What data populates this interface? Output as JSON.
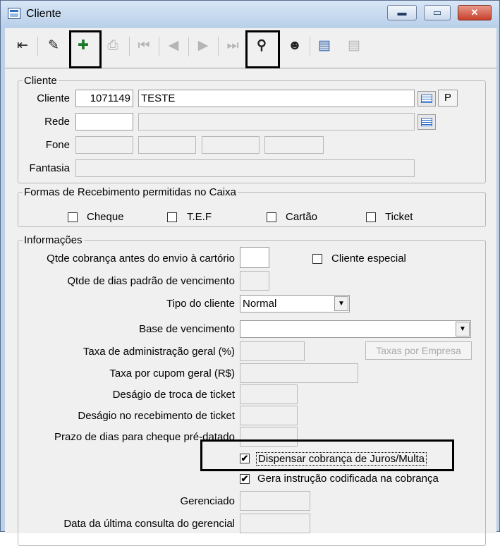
{
  "window": {
    "title": "Cliente",
    "controls": {
      "minimize": "▬",
      "maximize": "▭",
      "close": "✕"
    }
  },
  "toolbar": {
    "buttons": [
      {
        "name": "exit-icon",
        "glyph": "⇤"
      },
      {
        "name": "edit-icon",
        "glyph": "✎"
      },
      {
        "name": "add-icon",
        "glyph": "✚"
      },
      {
        "name": "save-icon",
        "glyph": "⎙"
      },
      {
        "name": "first-record-icon",
        "glyph": "⏮"
      },
      {
        "name": "prev-record-icon",
        "glyph": "◀"
      },
      {
        "name": "next-record-icon",
        "glyph": "▶"
      },
      {
        "name": "last-record-icon",
        "glyph": "⏭"
      },
      {
        "name": "binoculars-icon",
        "glyph": "⚲"
      },
      {
        "name": "person-icon",
        "glyph": "☻"
      },
      {
        "name": "document-icon",
        "glyph": "▤"
      },
      {
        "name": "document-disabled-icon",
        "glyph": "▤"
      }
    ]
  },
  "cliente": {
    "legend": "Cliente",
    "cliente_label": "Cliente",
    "cliente_code": "1071149",
    "cliente_name": "TESTE",
    "p_button": "P",
    "rede_label": "Rede",
    "fone_label": "Fone",
    "fantasia_label": "Fantasia"
  },
  "formas": {
    "legend": "Formas de Recebimento permitidas no Caixa",
    "options": [
      "Cheque",
      "T.E.F",
      "Cartão",
      "Ticket"
    ]
  },
  "informacoes": {
    "legend": "Informações",
    "qtde_cobranca_label": "Qtde cobrança antes do envio à cartório",
    "cliente_especial_label": "Cliente especial",
    "qtde_dias_label": "Qtde de dias padrão de vencimento",
    "tipo_cliente_label": "Tipo do cliente",
    "tipo_cliente_value": "Normal",
    "base_vencimento_label": "Base de vencimento",
    "taxa_adm_label": "Taxa de administração geral (%)",
    "taxas_empresa_button": "Taxas por  Empresa",
    "taxa_cupom_label": "Taxa por cupom geral (R$)",
    "desagio_troca_label": "Deságio de troca de ticket",
    "desagio_recebimento_label": "Deságio no recebimento de ticket",
    "prazo_cheque_label": "Prazo de dias para cheque pré-datado",
    "dispensar_label": "Dispensar cobrança de Juros/Multa",
    "dispensar_checked": "✔",
    "gera_instrucao_label": "Gera instrução codificada na cobrança",
    "gera_instrucao_checked": "✔",
    "gerenciado_label": "Gerenciado",
    "data_consulta_label": "Data da última consulta do gerencial"
  }
}
